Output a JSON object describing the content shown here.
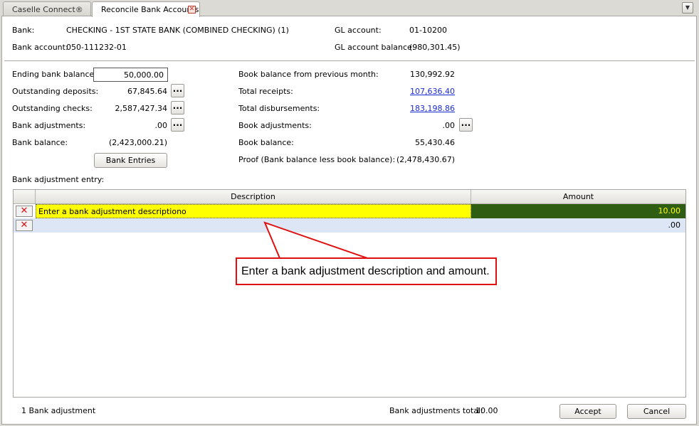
{
  "tabs": [
    {
      "label": "Caselle Connect®"
    },
    {
      "label": "Reconcile Bank Accounts"
    }
  ],
  "header": {
    "bank_label": "Bank:",
    "bank_value": "CHECKING - 1ST STATE BANK (COMBINED CHECKING) (1)",
    "bank_account_label": "Bank account:",
    "bank_account_value": "050-111232-01",
    "gl_account_label": "GL account:",
    "gl_account_value": "01-10200",
    "gl_balance_label": "GL account balance:",
    "gl_balance_value": "(980,301.45)"
  },
  "left": {
    "ending_label": "Ending bank balance:",
    "ending_value": "50,000.00",
    "deposits_label": "Outstanding deposits:",
    "deposits_value": "67,845.64",
    "checks_label": "Outstanding checks:",
    "checks_value": "2,587,427.34",
    "adjustments_label": "Bank adjustments:",
    "adjustments_value": ".00",
    "balance_label": "Bank balance:",
    "balance_value": "(2,423,000.21)",
    "entries_button": "Bank Entries"
  },
  "right": {
    "prev_label": "Book balance from previous month:",
    "prev_value": "130,992.92",
    "receipts_label": "Total receipts:",
    "receipts_value": "107,636.40",
    "disb_label": "Total disbursements:",
    "disb_value": "183,198.86",
    "book_adj_label": "Book adjustments:",
    "book_adj_value": ".00",
    "book_bal_label": "Book balance:",
    "book_bal_value": "55,430.46",
    "proof_label": "Proof (Bank balance less book balance):",
    "proof_value": "(2,478,430.67)"
  },
  "dots_label": "...",
  "grid": {
    "section_label": "Bank adjustment entry:",
    "col_description": "Description",
    "col_amount": "Amount",
    "rows": [
      {
        "description": "Enter a bank adjustment descriptiono",
        "amount": "10.00"
      },
      {
        "description": "",
        "amount": ".00"
      }
    ],
    "delete_glyph": "✕"
  },
  "callout": {
    "text": "Enter a bank adjustment description and amount."
  },
  "footer": {
    "count": "1 Bank adjustment",
    "total_label": "Bank adjustments total:",
    "total_value": "10.00",
    "accept_button": "Accept",
    "cancel_button": "Cancel"
  },
  "colors": {
    "selected_row": "#ffff00",
    "amount_cell": "#2f5e12",
    "amount_text": "#ffff00",
    "new_row": "#dce6f5",
    "callout_border": "#e01010"
  }
}
